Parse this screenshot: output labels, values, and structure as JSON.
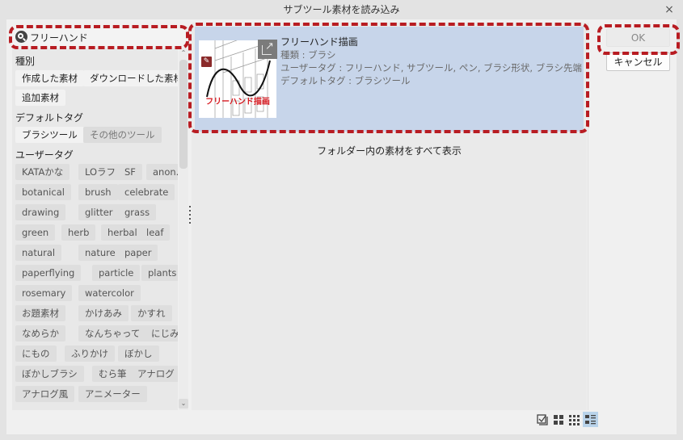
{
  "window": {
    "title": "サブツール素材を読み込み",
    "close_label": "×"
  },
  "search": {
    "value": "フリーハンド",
    "placeholder": ""
  },
  "filters": {
    "type_label": "種別",
    "type_tags": [
      {
        "label": "作成した素材",
        "state": "active"
      },
      {
        "label": "ダウンロードした素材",
        "state": "active"
      },
      {
        "label": "追加素材",
        "state": "active"
      }
    ],
    "default_tag_label": "デフォルトタグ",
    "default_tags": [
      {
        "label": "ブラシツール",
        "state": "active"
      },
      {
        "label": "その他のツール",
        "state": "dim"
      }
    ],
    "user_tag_label": "ユーザータグ",
    "user_tags": [
      "KATAかな",
      "LOラフ",
      "SF",
      "anon.",
      "botanical",
      "brush",
      "celebrate",
      "drawing",
      "glitter",
      "grass",
      "green",
      "herb",
      "herbal",
      "leaf",
      "natural",
      "nature",
      "paper",
      "paperflying",
      "particle",
      "plants",
      "rosemary",
      "watercolor",
      "お題素材",
      "かけあみ",
      "かすれ",
      "なめらか",
      "なんちゃって",
      "にじみ",
      "にもの",
      "ふりかけ",
      "ぼかし",
      "ぼかしブラシ",
      "むら筆",
      "アナログ",
      "アナログ風",
      "アニメーター"
    ]
  },
  "material": {
    "title": "フリーハンド描画",
    "thumbnail_label": "フリーハンド描画",
    "type_line": "種類 : ブラシ",
    "user_tags_line": "ユーザータグ : フリーハンド, サブツール, ペン, ブラシ形状, ブラシ先端",
    "default_tags_line": "デフォルトタグ : ブラシツール"
  },
  "show_all_label": "フォルダー内の素材をすべて表示",
  "buttons": {
    "ok": "OK",
    "cancel": "キャンセル"
  },
  "view_modes": [
    "select-all-icon",
    "large-grid-icon",
    "small-grid-icon",
    "list-detail-icon"
  ],
  "active_view_mode": "list-detail-icon",
  "colors": {
    "highlight": "#b81c22",
    "selected_item": "#c7d5ea",
    "active_view": "#b9d3ea"
  }
}
